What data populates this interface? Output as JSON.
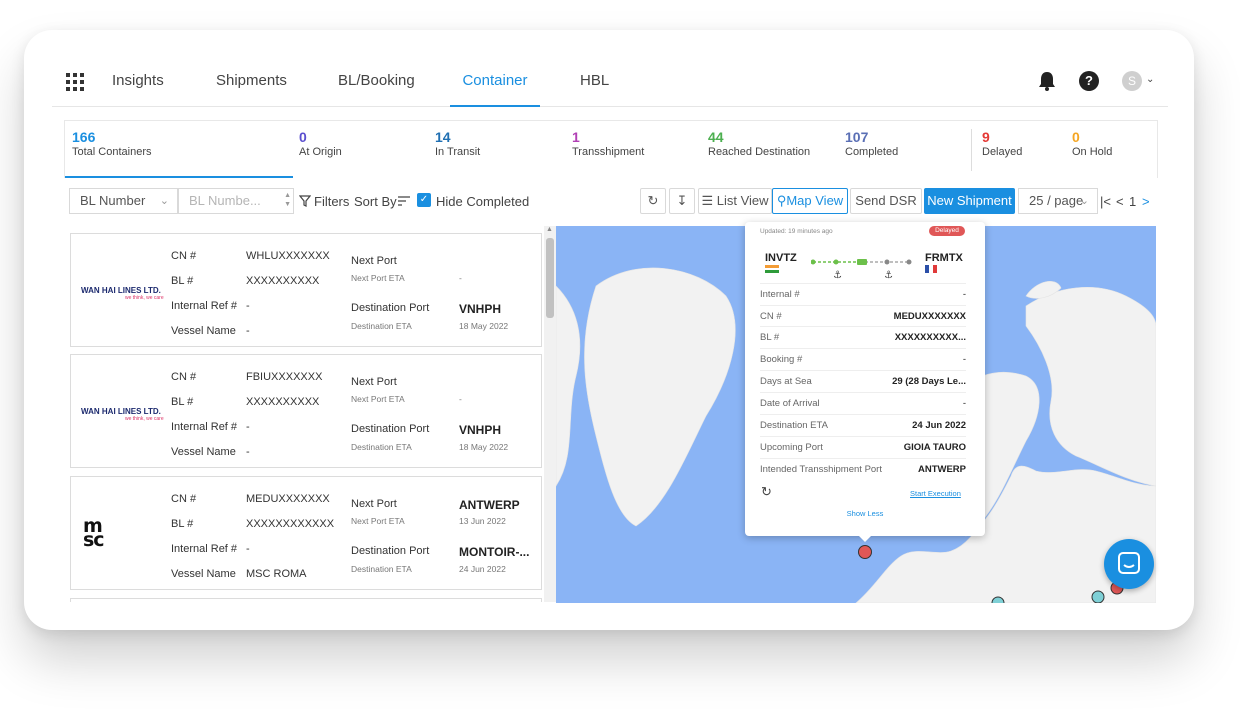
{
  "nav": {
    "tabs": [
      "Insights",
      "Shipments",
      "BL/Booking",
      "Container",
      "HBL"
    ],
    "active_tab": "Container",
    "avatar_initial": "S"
  },
  "stats": [
    {
      "value": "166",
      "label": "Total Containers",
      "color": "#1a8fe0"
    },
    {
      "value": "0",
      "label": "At Origin",
      "color": "#5b4fcf"
    },
    {
      "value": "14",
      "label": "In Transit",
      "color": "#1f6fb2"
    },
    {
      "value": "1",
      "label": "Transshipment",
      "color": "#b13fb5"
    },
    {
      "value": "44",
      "label": "Reached Destination",
      "color": "#4caf50"
    },
    {
      "value": "107",
      "label": "Completed",
      "color": "#5a6fb5"
    },
    {
      "value": "9",
      "label": "Delayed",
      "color": "#e53935"
    },
    {
      "value": "0",
      "label": "On Hold",
      "color": "#f5a623"
    }
  ],
  "toolbar": {
    "search_type": "BL Number",
    "search_placeholder": "BL Numbe...",
    "filters": "Filters",
    "sort_by": "Sort By",
    "hide_completed": "Hide Completed",
    "list_view": "List View",
    "map_view": "Map View",
    "send_dsr": "Send DSR",
    "new_shipment": "New Shipment",
    "page_size": "25 / page",
    "page": "1"
  },
  "list": {
    "labels": {
      "cn": "CN #",
      "bl": "BL #",
      "internal_ref": "Internal Ref #",
      "vessel": "Vessel Name",
      "next_port": "Next Port",
      "next_port_eta": "Next Port ETA",
      "dest_port": "Destination Port",
      "dest_eta": "Destination ETA"
    },
    "cards": [
      {
        "logo": "WAN HAI LINES LTD.",
        "logo_sub": "we think, we care",
        "cn": "WHLUXXXXXXX",
        "bl": "XXXXXXXXXX",
        "internal_ref": "-",
        "vessel": "-",
        "next_port": "",
        "next_port_eta": "-",
        "dest_port": "VNHPH",
        "dest_eta": "18 May 2022"
      },
      {
        "logo": "WAN HAI LINES LTD.",
        "logo_sub": "we think, we care",
        "cn": "FBIUXXXXXXX",
        "bl": "XXXXXXXXXX",
        "internal_ref": "-",
        "vessel": "-",
        "next_port": "",
        "next_port_eta": "-",
        "dest_port": "VNHPH",
        "dest_eta": "18 May 2022"
      },
      {
        "logo": "msc",
        "logo_sub": "",
        "cn": "MEDUXXXXXXX",
        "bl": "XXXXXXXXXXXX",
        "internal_ref": "-",
        "vessel": "MSC ROMA",
        "next_port": "ANTWERP",
        "next_port_eta": "13 Jun 2022",
        "dest_port": "MONTOIR-...",
        "dest_eta": "24 Jun 2022"
      }
    ]
  },
  "popup": {
    "updated": "Updated: 19 minutes ago",
    "status": "Delayed",
    "origin": "INVTZ",
    "destination": "FRMTX",
    "rows": [
      {
        "label": "Internal #",
        "value": "-"
      },
      {
        "label": "CN #",
        "value": "MEDUXXXXXXX"
      },
      {
        "label": "BL #",
        "value": "XXXXXXXXXX..."
      },
      {
        "label": "Booking #",
        "value": "-"
      },
      {
        "label": "Days at Sea",
        "value": "29 (28 Days Le..."
      },
      {
        "label": "Date of Arrival",
        "value": "-"
      },
      {
        "label": "Destination ETA",
        "value": "24 Jun 2022"
      },
      {
        "label": "Upcoming Port",
        "value": "GIOIA TAURO"
      },
      {
        "label": "Intended Transshipment Port",
        "value": "ANTWERP"
      }
    ],
    "start_execution": "Start Execution",
    "show_less": "Show Less"
  },
  "colors": {
    "accent": "#1a8fe0",
    "ocean": "#8ab4f5",
    "land": "#f2f2f2",
    "delayed": "#e05757"
  }
}
